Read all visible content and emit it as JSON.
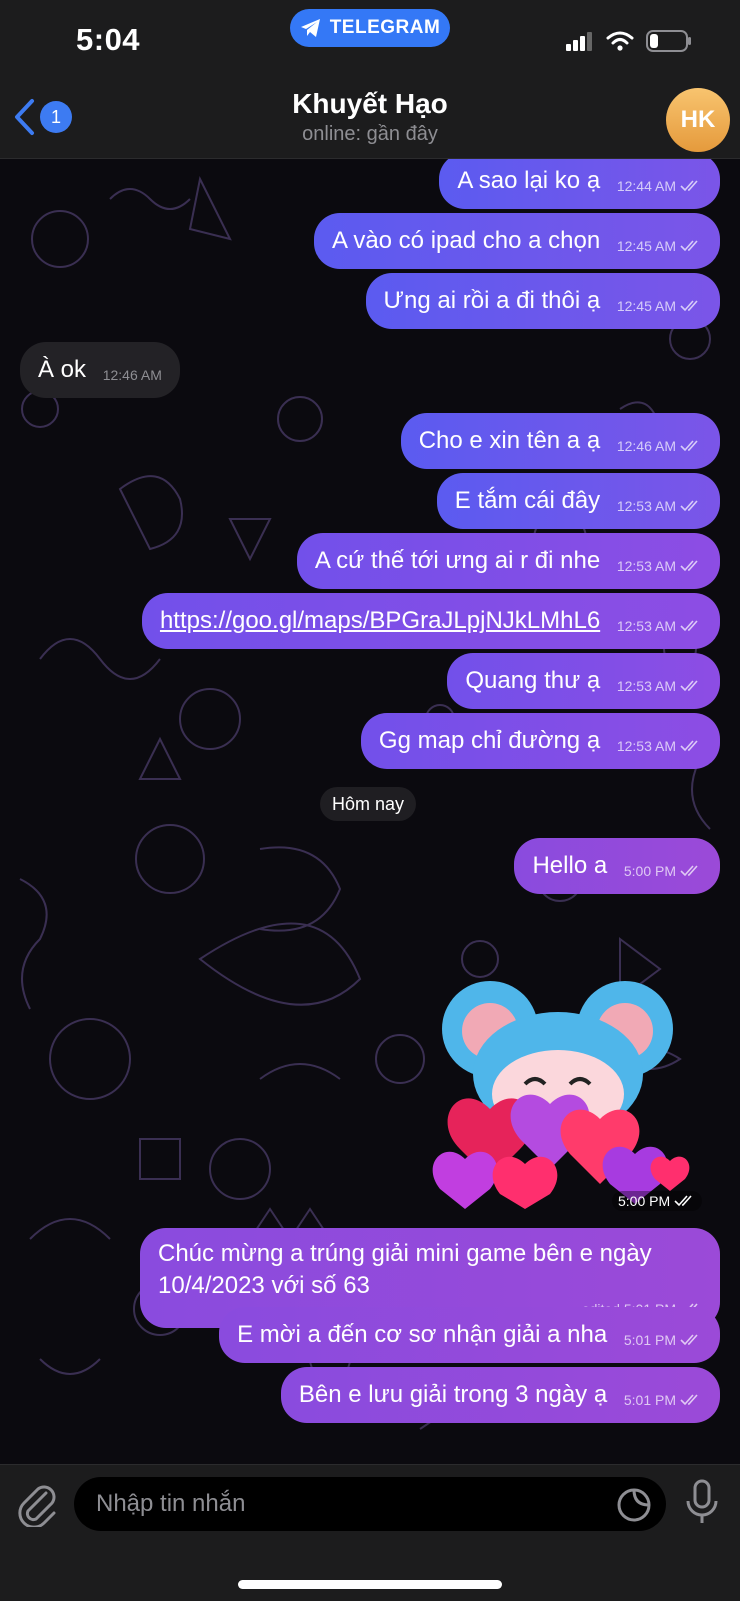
{
  "status_bar": {
    "time": "5:04",
    "pill_label": "TELEGRAM"
  },
  "header": {
    "back_badge": "1",
    "chat_name": "Khuyết Hạo",
    "chat_status": "online: gần đây",
    "avatar_initials": "HK"
  },
  "messages": [
    {
      "text": "A sao lại ko ạ",
      "time": "12:44 AM"
    },
    {
      "text": "A vào có ipad cho a chọn",
      "time": "12:45 AM"
    },
    {
      "text": "Ưng ai rồi a đi thôi ạ",
      "time": "12:45 AM"
    },
    {
      "text": "À ok",
      "time": "12:46 AM"
    },
    {
      "text": "Cho e xin tên a ạ",
      "time": "12:46 AM"
    },
    {
      "text": "E tắm cái đây",
      "time": "12:53 AM"
    },
    {
      "text": "A cứ thế tới ưng ai r đi nhe",
      "time": "12:53 AM"
    },
    {
      "text": "https://goo.gl/maps/BPGraJLpjNJkLMhL6",
      "time": "12:53 AM"
    },
    {
      "text": "Quang thư ạ",
      "time": "12:53 AM"
    },
    {
      "text": "Gg map chỉ đường ạ",
      "time": "12:53 AM"
    },
    {
      "text": "Hello a",
      "time": "5:00 PM"
    },
    {
      "text": "Chúc mừng a trúng giải mini game bên e ngày 10/4/2023 với số 63",
      "time": "edited 5:01 PM"
    },
    {
      "text": "E mời a đến cơ sơ nhận giải a nha",
      "time": "5:01 PM"
    },
    {
      "text": "Bên e lưu giải trong 3 ngày ạ",
      "time": "5:01 PM"
    }
  ],
  "day_divider": "Hôm nay",
  "sticker": {
    "time": "5:00 PM"
  },
  "input": {
    "placeholder": "Nhập tin nhắn"
  },
  "colors": {
    "accent": "#3478f6",
    "bubble_out_start": "#5b5bf0",
    "bubble_out_end": "#9b4ad8",
    "bubble_in": "#232226",
    "avatar": "#f0ad52"
  },
  "icons": [
    "telegram-icon",
    "signal-icon",
    "wifi-icon",
    "battery-icon",
    "back-chevron-icon",
    "double-check-icon",
    "attach-icon",
    "sticker-icon",
    "mic-icon"
  ]
}
